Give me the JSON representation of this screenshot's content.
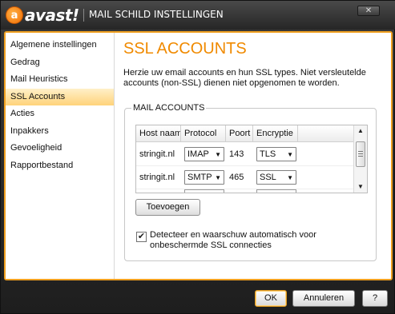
{
  "window": {
    "logo_glyph": "a",
    "logo_text": "avast!",
    "title": "MAIL SCHILD INSTELLINGEN",
    "close_label": "✕"
  },
  "sidebar": {
    "items": [
      {
        "label": "Algemene instellingen"
      },
      {
        "label": "Gedrag"
      },
      {
        "label": "Mail Heuristics"
      },
      {
        "label": "SSL Accounts"
      },
      {
        "label": "Acties"
      },
      {
        "label": "Inpakkers"
      },
      {
        "label": "Gevoeligheid"
      },
      {
        "label": "Rapportbestand"
      }
    ],
    "active_index": 3
  },
  "main": {
    "title": "SSL ACCOUNTS",
    "description": "Herzie uw email accounts en hun SSL types. Niet versleutelde accounts (non-SSL) dienen niet opgenomen te worden.",
    "group_label": "MAIL ACCOUNTS",
    "table": {
      "headers": [
        "Host naam",
        "Protocol",
        "Poort",
        "Encryptie"
      ],
      "rows": [
        {
          "host": "stringit.nl",
          "protocol": "IMAP",
          "port": "143",
          "encryption": "TLS"
        },
        {
          "host": "stringit.nl",
          "protocol": "SMTP",
          "port": "465",
          "encryption": "SSL"
        }
      ],
      "dropdown_arrow": "▼"
    },
    "scroll": {
      "up": "▲",
      "down": "▼"
    },
    "add_button": "Toevoegen",
    "checkbox": {
      "checked": true,
      "mark": "✔",
      "label": "Detecteer en waarschuw automatisch voor onbeschermde SSL connecties"
    }
  },
  "footer": {
    "ok": "OK",
    "cancel": "Annuleren",
    "help": "?"
  },
  "colors": {
    "accent": "#f08a00",
    "border": "#f0a020",
    "active_item": "#ffd37a"
  }
}
